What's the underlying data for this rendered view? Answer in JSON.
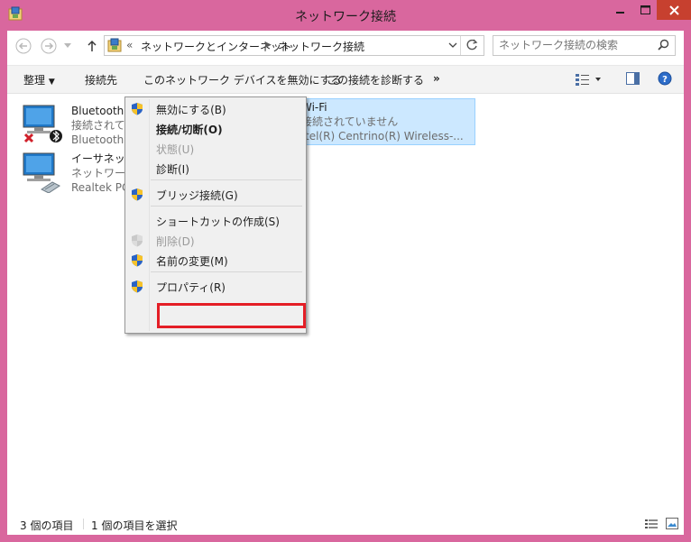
{
  "window": {
    "title": "ネットワーク接続"
  },
  "addressbar": {
    "prefix": "«",
    "crumbs": [
      "ネットワークとインターネット",
      "ネットワーク接続"
    ],
    "search_placeholder": "ネットワーク接続の検索"
  },
  "toolbar": {
    "organize": "整理",
    "connect_to": "接続先",
    "disable_device": "このネットワーク デバイスを無効にする",
    "diagnose": "この接続を診断する",
    "more": "»"
  },
  "connections": [
    {
      "name": "Bluetooth ネットワーク接続",
      "status": "接続されていません",
      "device": "Bluetooth"
    },
    {
      "name": "イーサネット",
      "status": "ネットワーク",
      "device": "Realtek PCI"
    },
    {
      "name": "Wi-Fi",
      "status": "接続されていません",
      "device": "tel(R) Centrino(R) Wireless-..."
    }
  ],
  "context_menu": {
    "items": [
      {
        "label": "無効にする(B)",
        "shield": true,
        "disabled": false,
        "bold": false
      },
      {
        "label": "接続/切断(O)",
        "shield": false,
        "disabled": false,
        "bold": true
      },
      {
        "label": "状態(U)",
        "shield": false,
        "disabled": true,
        "bold": false
      },
      {
        "label": "診断(I)",
        "shield": false,
        "disabled": false,
        "bold": false
      },
      {
        "label": "ブリッジ接続(G)",
        "shield": true,
        "disabled": false,
        "bold": false
      },
      {
        "label": "ショートカットの作成(S)",
        "shield": false,
        "disabled": false,
        "bold": false
      },
      {
        "label": "削除(D)",
        "shield": true,
        "disabled": true,
        "bold": false
      },
      {
        "label": "名前の変更(M)",
        "shield": true,
        "disabled": false,
        "bold": false
      },
      {
        "label": "プロパティ(R)",
        "shield": true,
        "disabled": false,
        "bold": false
      }
    ]
  },
  "statusbar": {
    "item_count": "3 個の項目",
    "selected_count": "1 個の項目を選択"
  },
  "colors": {
    "window_frame": "#d9679e",
    "selection_bg": "#cce8ff",
    "highlight_box": "#e41e26",
    "close_button": "#c7402f"
  }
}
